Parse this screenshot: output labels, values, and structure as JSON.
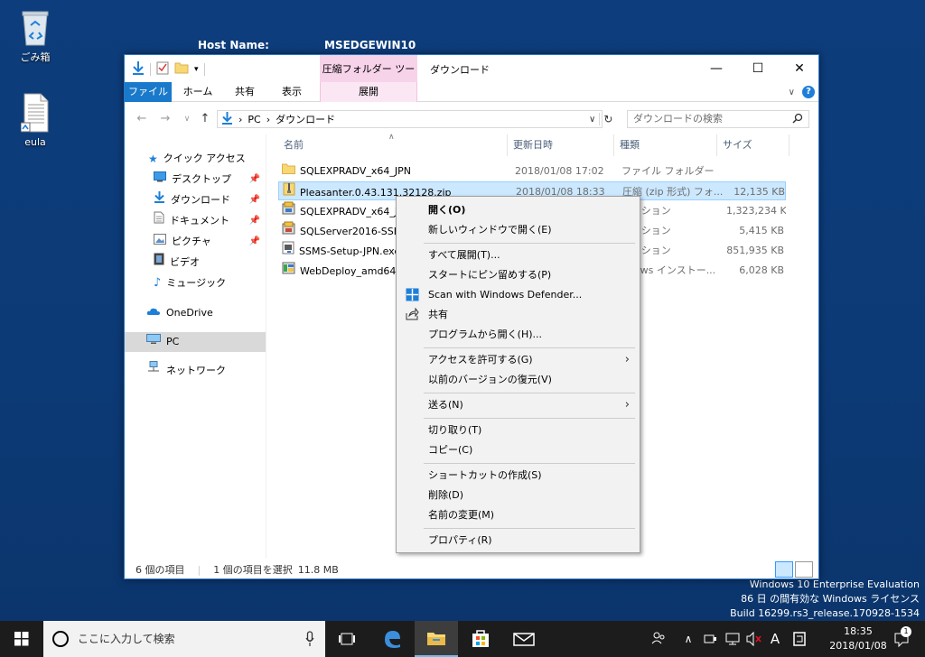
{
  "desktop": {
    "icons": [
      {
        "label": "ごみ箱",
        "icon": "recycle-bin-icon"
      },
      {
        "label": "eula",
        "icon": "document-icon"
      }
    ],
    "bginfo": {
      "host_label": "Host Name:",
      "host_value": "MSEDGEWIN10"
    },
    "watermark": {
      "line1": "Windows 10 Enterprise Evaluation",
      "line2": "86 日 の間有効な Windows ライセンス",
      "line3": "Build 16299.rs3_release.170928-1534"
    }
  },
  "explorer": {
    "title": "ダウンロード",
    "context_tab_header": "圧縮フォルダー ツール",
    "tabs": {
      "file": "ファイル",
      "home": "ホーム",
      "share": "共有",
      "view": "表示",
      "extract": "展開"
    },
    "address": {
      "pc": "PC",
      "folder": "ダウンロード",
      "sep": "›"
    },
    "search_placeholder": "ダウンロードの検索",
    "nav": {
      "quick_access": "クイック アクセス",
      "desktop": "デスクトップ",
      "downloads": "ダウンロード",
      "documents": "ドキュメント",
      "pictures": "ピクチャ",
      "videos": "ビデオ",
      "music": "ミュージック",
      "onedrive": "OneDrive",
      "pc": "PC",
      "network": "ネットワーク"
    },
    "columns": {
      "name": "名前",
      "date": "更新日時",
      "type": "種類",
      "size": "サイズ"
    },
    "files": [
      {
        "name": "SQLEXPRADV_x64_JPN",
        "date": "2018/01/08 17:02",
        "type": "ファイル フォルダー",
        "size": ""
      },
      {
        "name": "Pleasanter.0.43.131.32128.zip",
        "date": "2018/01/08 18:33",
        "type": "圧縮 (zip 形式) フォ...",
        "size": "12,135 KB"
      },
      {
        "name": "SQLEXPRADV_x64_JP",
        "date": "",
        "type": "ケーション",
        "size": "1,323,234 KB"
      },
      {
        "name": "SQLServer2016-SSEI-",
        "date": "",
        "type": "ケーション",
        "size": "5,415 KB"
      },
      {
        "name": "SSMS-Setup-JPN.exe",
        "date": "",
        "type": "ケーション",
        "size": "851,935 KB"
      },
      {
        "name": "WebDeploy_amd64_j",
        "date": "",
        "type": "ndows インストー...",
        "size": "6,028 KB"
      }
    ],
    "status": {
      "count": "6 個の項目",
      "selected": "1 個の項目を選択",
      "size": "11.8 MB"
    }
  },
  "context_menu": {
    "open": "開く(O)",
    "open_new_window": "新しいウィンドウで開く(E)",
    "extract_all": "すべて展開(T)...",
    "pin_start": "スタートにピン留めする(P)",
    "scan_defender": "Scan with Windows Defender...",
    "share": "共有",
    "open_with": "プログラムから開く(H)...",
    "give_access": "アクセスを許可する(G)",
    "restore_versions": "以前のバージョンの復元(V)",
    "send_to": "送る(N)",
    "cut": "切り取り(T)",
    "copy": "コピー(C)",
    "create_shortcut": "ショートカットの作成(S)",
    "delete": "削除(D)",
    "rename": "名前の変更(M)",
    "properties": "プロパティ(R)"
  },
  "taskbar": {
    "search_placeholder": "ここに入力して検索",
    "ime": "A",
    "time": "18:35",
    "date": "2018/01/08",
    "notification_count": "1"
  }
}
